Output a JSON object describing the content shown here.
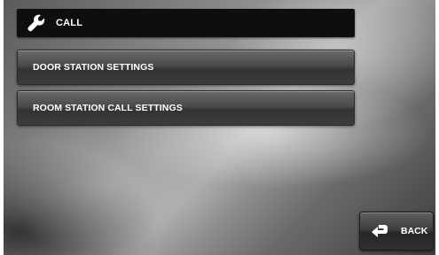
{
  "header": {
    "title": "CALL",
    "icon": "wrench-icon"
  },
  "menu": {
    "items": [
      {
        "label": "DOOR STATION SETTINGS"
      },
      {
        "label": "ROOM STATION CALL SETTINGS"
      }
    ]
  },
  "footer": {
    "back_label": "BACK",
    "back_icon": "return-arrow-icon"
  },
  "colors": {
    "header_bg": "#0e0e0e",
    "button_bg": "#4a4a4a",
    "text": "#ffffff"
  }
}
